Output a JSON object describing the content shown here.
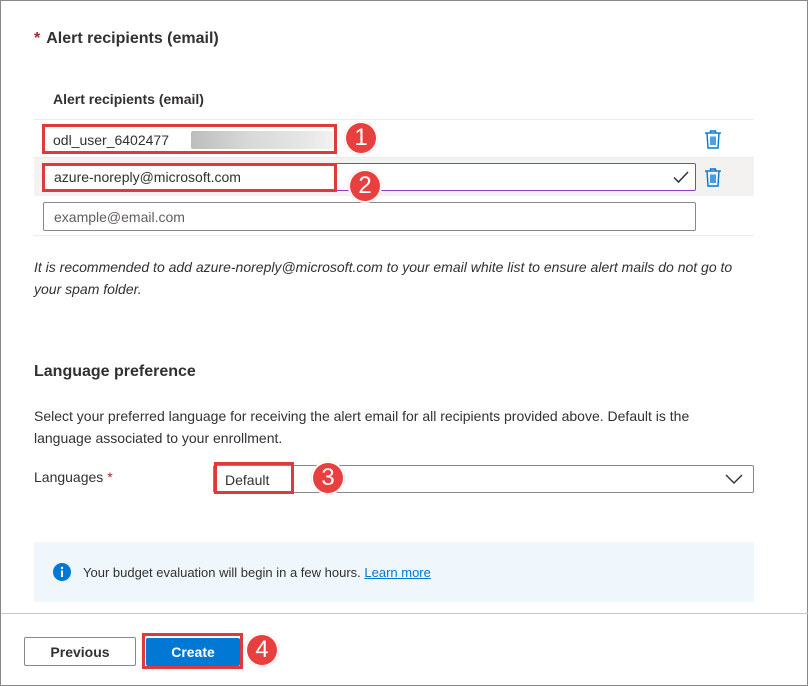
{
  "alert_section": {
    "required_marker": "*",
    "title": "Alert recipients (email)",
    "column_header": "Alert recipients (email)",
    "recipients": [
      {
        "email": "odl_user_6402477"
      },
      {
        "email": "azure-noreply@microsoft.com"
      }
    ],
    "new_email_placeholder": "example@email.com",
    "note": "It is recommended to add azure-noreply@microsoft.com to your email white list to ensure alert mails do not go to your spam folder."
  },
  "language_section": {
    "title": "Language preference",
    "description": "Select your preferred language for receiving the alert email for all recipients provided above. Default is the language associated to your enrollment.",
    "languages_label": "Languages",
    "required_marker": "*",
    "selected_language": "Default"
  },
  "info_bar": {
    "icon": "info-icon",
    "message": "Your budget evaluation will begin in a few hours.",
    "link_label": "Learn more"
  },
  "footer": {
    "previous_label": "Previous",
    "create_label": "Create"
  },
  "callouts": {
    "step1": "1",
    "step2": "2",
    "step3": "3",
    "step4": "4"
  },
  "colors": {
    "accent": "#0078d4",
    "required": "#a4262c",
    "callout": "#e0393c",
    "info_bg": "#eff6fc"
  }
}
